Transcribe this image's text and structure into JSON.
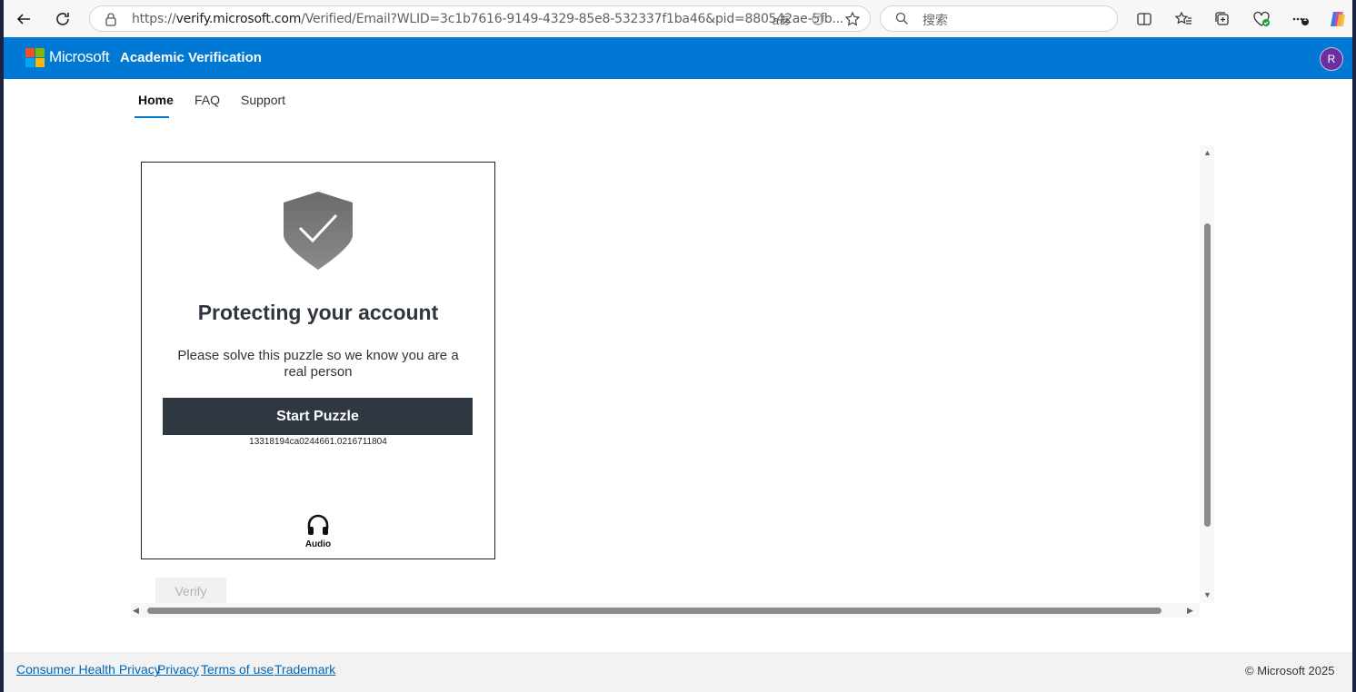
{
  "browser": {
    "url_prefix": "https://",
    "url_domain": "verify.microsoft.com",
    "url_rest": "/Verified/Email?WLID=3c1b7616-9149-4329-85e8-532337f1ba46&pid=880542ae-5fb...",
    "read_aloud_label": "aあ",
    "search_placeholder": "搜索",
    "more_badge": "1"
  },
  "header": {
    "brand": "Microsoft",
    "product": "Academic Verification",
    "avatar_initial": "R",
    "logo_colors": [
      "#f25022",
      "#7fba00",
      "#00a4ef",
      "#ffb900"
    ]
  },
  "nav": {
    "items": [
      {
        "label": "Home",
        "active": true
      },
      {
        "label": "FAQ",
        "active": false
      },
      {
        "label": "Support",
        "active": false
      }
    ]
  },
  "puzzle": {
    "title": "Protecting your account",
    "description": "Please solve this puzzle so we know you are a real person",
    "start_label": "Start Puzzle",
    "session_id": "13318194ca0244661.0216711804",
    "audio_label": "Audio"
  },
  "verify_label": "Verify",
  "footer": {
    "links": [
      "Consumer Health Privacy",
      "Privacy",
      "Terms of use",
      "Trademark"
    ],
    "copyright": "© Microsoft 2025"
  },
  "colors": {
    "header_bg": "#0078d4",
    "button_dark": "#2f3740",
    "link": "#0067b8"
  }
}
